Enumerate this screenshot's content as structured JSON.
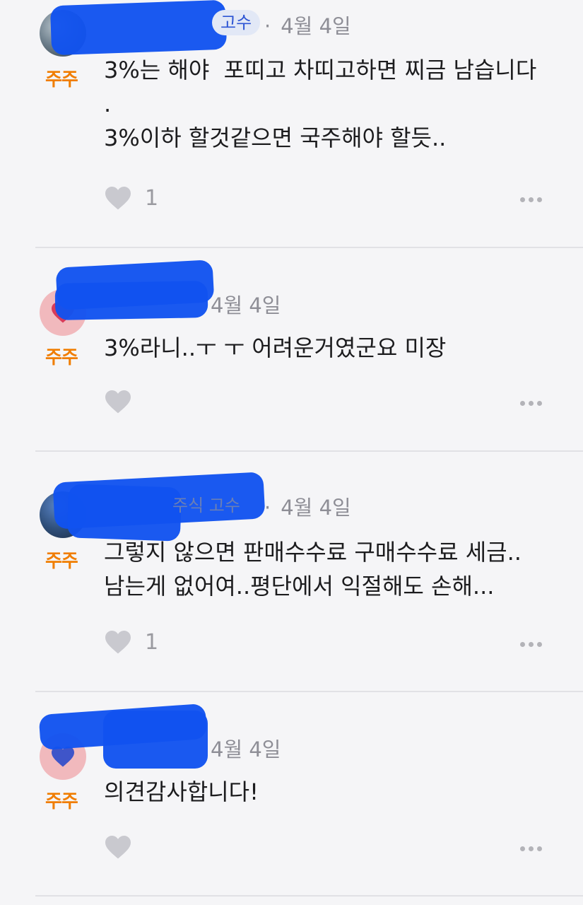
{
  "comments": [
    {
      "badge": "주주",
      "name_partial": "고수",
      "separator": "·",
      "date": "4월 4일",
      "text": "3%는 해야  포띠고 차띠고하면 찌금 남습니다\n.\n3%이하 할것같으면 국주해야 할듯..",
      "like_count": "1"
    },
    {
      "badge": "주주",
      "date": "4월 4일",
      "text": "3%라니..ㅜ ㅜ 어려운거였군요 미장",
      "like_count": ""
    },
    {
      "badge": "주주",
      "name_partial": "주식 고수",
      "separator": "·",
      "date": "4월 4일",
      "text": "그렇지 않으면 판매수수료 구매수수료 세금..\n남는게 없어여..평단에서 익절해도 손해...",
      "like_count": "1"
    },
    {
      "badge": "주주",
      "date": "4월 4일",
      "text": "의견감사합니다!",
      "like_count": ""
    }
  ],
  "colors": {
    "background": "#f5f5f7",
    "badge": "#f07d00",
    "meta": "#8e8e96",
    "redaction": "#1152ef",
    "heart_outline": "#c9c9cf"
  },
  "icons": {
    "like": "heart-icon",
    "more": "more-dots-icon"
  }
}
